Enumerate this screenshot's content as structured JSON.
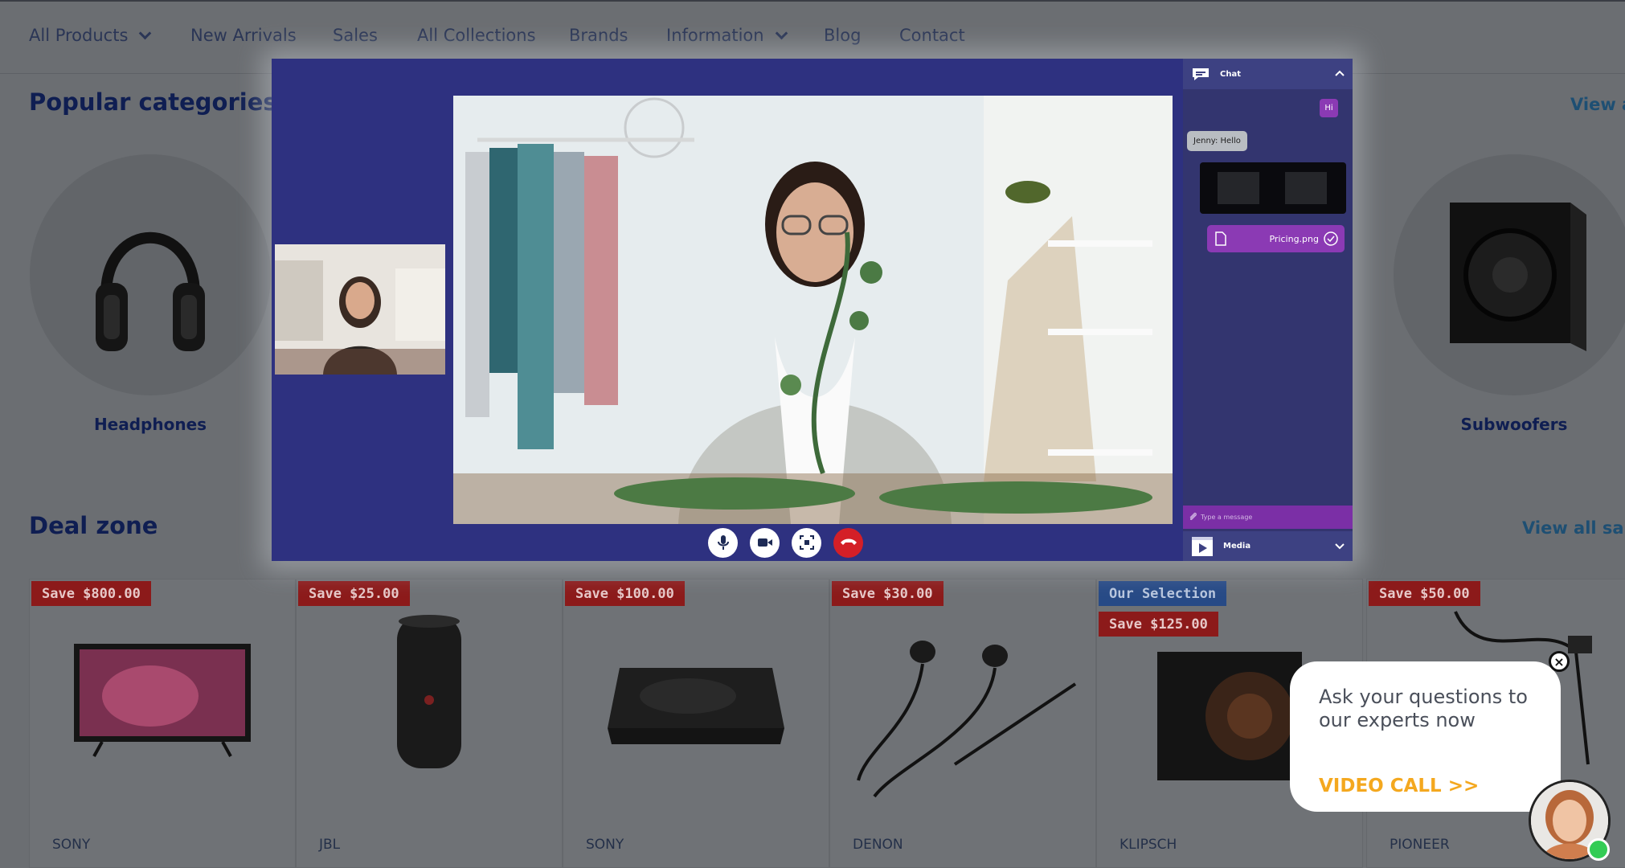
{
  "nav": {
    "items": [
      {
        "label": "All Products",
        "has_dropdown": true
      },
      {
        "label": "New Arrivals",
        "has_dropdown": false
      },
      {
        "label": "Sales",
        "has_dropdown": false
      },
      {
        "label": "All Collections",
        "has_dropdown": false
      },
      {
        "label": "Brands",
        "has_dropdown": false
      },
      {
        "label": "Information",
        "has_dropdown": true
      },
      {
        "label": "Blog",
        "has_dropdown": false
      },
      {
        "label": "Contact",
        "has_dropdown": false
      }
    ]
  },
  "categories": {
    "title": "Popular categories",
    "view_all": "View al",
    "items": [
      {
        "label": "Headphones",
        "icon": "headphones-icon"
      },
      {
        "label": "Subwoofers",
        "icon": "subwoofer-icon"
      }
    ]
  },
  "deals": {
    "title": "Deal zone",
    "view_all": "View all sale",
    "products": [
      {
        "badges": [
          "Save $800.00"
        ],
        "brand": "SONY",
        "icon": "tv-icon"
      },
      {
        "badges": [
          "Save $25.00"
        ],
        "brand": "JBL",
        "icon": "speaker-icon"
      },
      {
        "badges": [
          "Save $100.00"
        ],
        "brand": "SONY",
        "icon": "turntable-icon"
      },
      {
        "badges": [
          "Save $30.00"
        ],
        "brand": "DENON",
        "icon": "earphones-icon"
      },
      {
        "badges": [
          "Our Selection",
          "Save $125.00"
        ],
        "brand": "KLIPSCH",
        "icon": "subwoofer-icon"
      },
      {
        "badges": [
          "Save $50.00"
        ],
        "brand": "PIONEER",
        "icon": "cable-icon"
      }
    ]
  },
  "video_call": {
    "chat": {
      "title": "Chat",
      "messages": [
        {
          "from": "me",
          "text": "Hi"
        },
        {
          "from": "them",
          "text": "Jenny: Hello"
        }
      ],
      "file_name": "Pricing.png",
      "input_placeholder": "Type a message"
    },
    "media_title": "Media"
  },
  "popup": {
    "text": "Ask your questions to our experts now",
    "cta": "VIDEO CALL >>",
    "close": "×"
  },
  "colors": {
    "modal_bg": "#2e3180",
    "chat_accent": "#8b3ab4",
    "badge_red": "#8c1a1a",
    "badge_blue": "#274a86",
    "cta_orange": "#f4a81f",
    "end_call_red": "#d41f27",
    "online_green": "#33cc55"
  }
}
